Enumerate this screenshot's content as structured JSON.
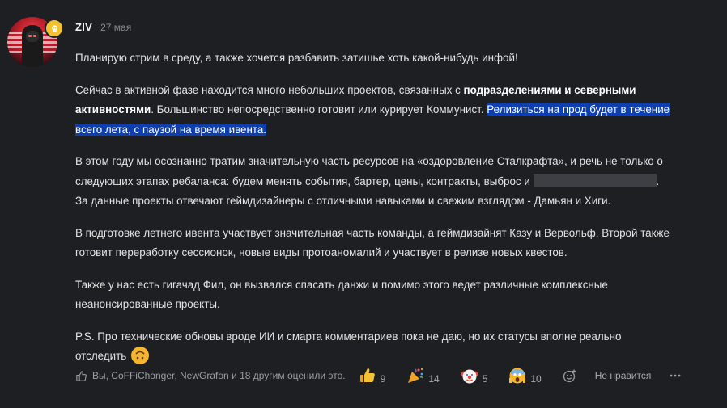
{
  "post": {
    "author": "ZIV",
    "date": "27 мая",
    "paragraphs": {
      "p1": "Планирую стрим в среду, а также хочется разбавить затишье хоть какой-нибудь инфой!",
      "p2_a": "Сейчас в активной фазе находится много небольших проектов, связанных с ",
      "p2_bold": "подразделениями и северными активностями",
      "p2_b": ". Большинство непосредственно готовит или курирует Коммунист. ",
      "p2_highlight": "Релизиться на прод будет в течение всего лета, с паузой на время ивента.",
      "p3_a": "В этом году мы осознанно тратим значительную часть ресурсов на «оздоровление Сталкрафта», и речь не только о следующих этапах ребаланса: будем менять события, бартер, цены, контракты, выброс и ",
      "p3_b": ". За данные проекты отвечают геймдизайнеры с отличными навыками и свежим взглядом - Дамьян и Хиги.",
      "p4": "В подготовке летнего ивента участвует значительная часть команды, а геймдизайнят Казу и Вервольф. Второй также готовит переработку сессионок, новые виды протоаномалий и участвует в релизе новых квестов.",
      "p5": "Также у нас есть гигачад Фил, он вызвался спасать данжи и помимо этого ведет различные комплексные неанонсированные проекты.",
      "p6": "P.S. Про технические обновы вроде ИИ и смарта комментариев пока не даю, но их статусы вполне реально отследить "
    }
  },
  "footer": {
    "likes_text": "Вы, CoFFiChonger, NewGrafon и 18 другим оценили это.",
    "reactions": [
      {
        "icon": "thumbs-up-icon",
        "count": "9"
      },
      {
        "icon": "party-popper-icon",
        "count": "14"
      },
      {
        "icon": "clown-face-icon",
        "count": "5"
      },
      {
        "icon": "screaming-face-icon",
        "count": "10"
      }
    ],
    "dislike_label": "Не нравится"
  },
  "colors": {
    "background": "#1e1f23",
    "highlight": "#0e3fb0",
    "badge": "#f2c230",
    "muted": "#8b8d93"
  }
}
